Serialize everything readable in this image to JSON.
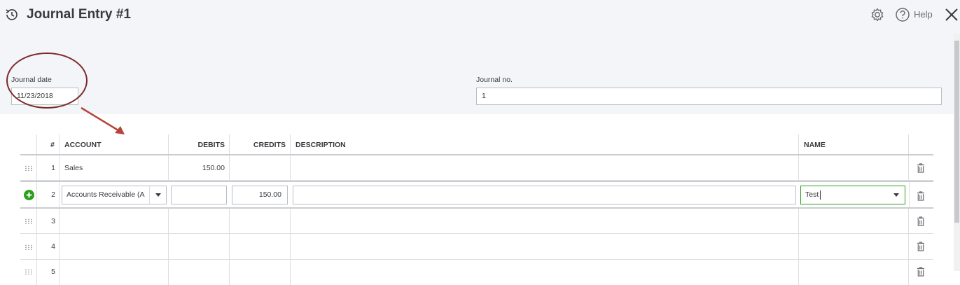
{
  "header": {
    "title": "Journal Entry #1",
    "help_label": "Help"
  },
  "form": {
    "journal_date_label": "Journal date",
    "journal_date_value": "11/23/2018",
    "journal_no_label": "Journal no.",
    "journal_no_value": "1"
  },
  "table": {
    "columns": {
      "num": "#",
      "account": "ACCOUNT",
      "debits": "DEBITS",
      "credits": "CREDITS",
      "description": "DESCRIPTION",
      "name": "NAME"
    },
    "rows": [
      {
        "num": "1",
        "account": "Sales",
        "debits": "150.00",
        "credits": "",
        "description": "",
        "name": ""
      },
      {
        "num": "2",
        "account": "Accounts Receivable (A",
        "debits": "",
        "credits": "150.00",
        "description": "",
        "name": "Test"
      },
      {
        "num": "3",
        "account": "",
        "debits": "",
        "credits": "",
        "description": "",
        "name": ""
      },
      {
        "num": "4",
        "account": "",
        "debits": "",
        "credits": "",
        "description": "",
        "name": ""
      },
      {
        "num": "5",
        "account": "",
        "debits": "",
        "credits": "",
        "description": "",
        "name": ""
      }
    ]
  },
  "colors": {
    "header_bg": "#f4f5f8",
    "add_green": "#2ca01c",
    "annotation": "#7b2a2a"
  },
  "icons": [
    "history-icon",
    "gear-icon",
    "help-icon",
    "close-icon",
    "drag-handle-icon",
    "add-line-icon",
    "trash-icon",
    "chevron-down-icon"
  ]
}
